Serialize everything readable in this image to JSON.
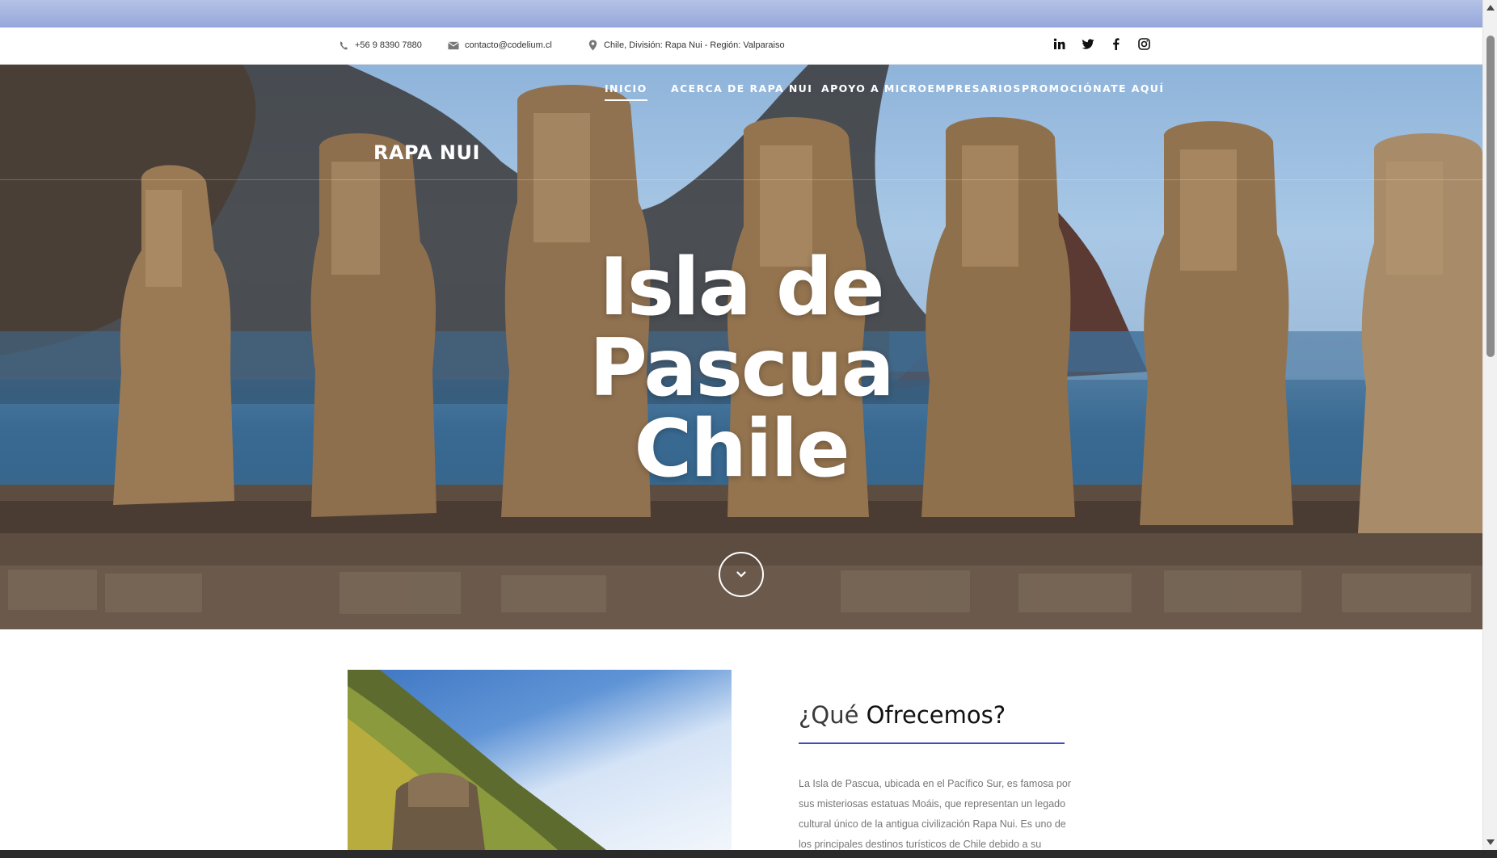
{
  "contact_bar": {
    "phone": "+56 9 8390 7880",
    "email": "contacto@codelium.cl",
    "location": "Chile, División: Rapa Nui - Región: Valparaiso",
    "social": [
      "linkedin-icon",
      "twitter-icon",
      "facebook-icon",
      "instagram-icon"
    ]
  },
  "header": {
    "logo": "RAPA NUI",
    "nav": [
      {
        "label": "INICIO",
        "active": true
      },
      {
        "label": "ACERCA DE RAPA NUI",
        "active": false
      },
      {
        "label": "APOYO A MICROEMPRESARIOS",
        "active": false
      },
      {
        "label": "PROMOCIÓNATE AQUÍ",
        "active": false
      }
    ]
  },
  "hero": {
    "title_line1": "Isla de",
    "title_line2": "Pascua",
    "title_line3": "Chile"
  },
  "offer": {
    "title_part1": "¿Qué",
    "title_part2": "Ofrecemos?",
    "body": "La Isla de Pascua, ubicada en el Pacífico Sur, es famosa por sus misteriosas estatuas Moáis, que representan un legado cultural único de la antigua civilización Rapa Nui. Es uno de los principales destinos turísticos de Chile debido a su"
  },
  "colors": {
    "accent": "#3f4bb8",
    "text_dark": "#111111",
    "text_body": "#777777"
  }
}
